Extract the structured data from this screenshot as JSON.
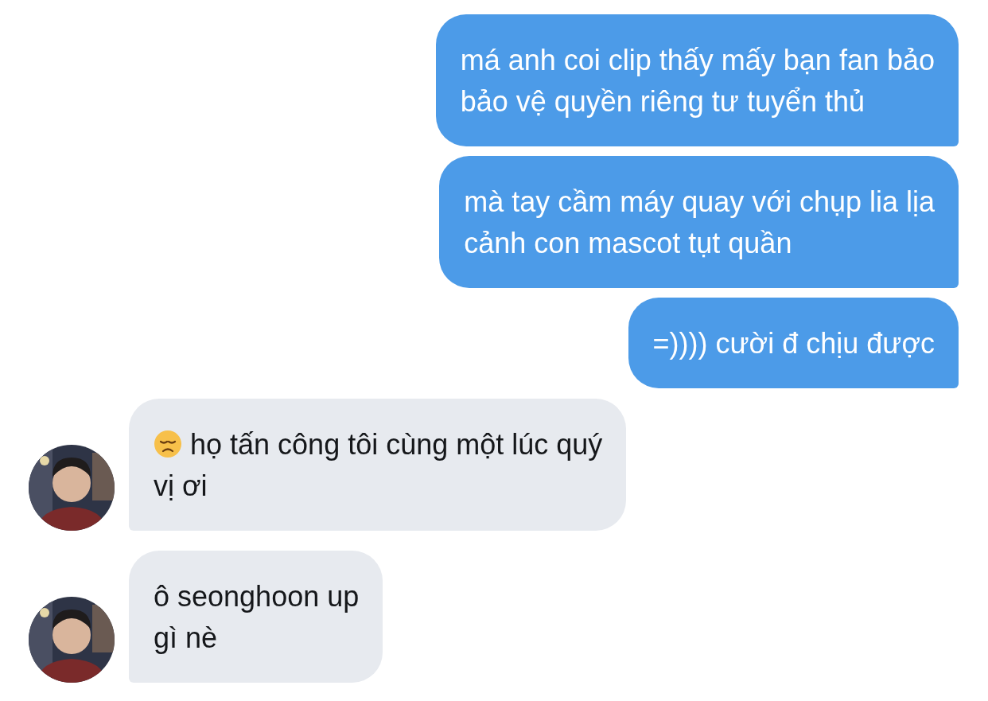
{
  "messages": [
    {
      "kind": "outgoing",
      "lines": [
        "má anh coi clip thấy mấy bạn fan bảo",
        "bảo vệ quyền riêng tư tuyển thủ"
      ]
    },
    {
      "kind": "outgoing",
      "lines": [
        "mà tay cầm máy quay với chụp lia lịa",
        "cảnh con mascot tụt quần"
      ]
    },
    {
      "kind": "outgoing",
      "lines": [
        "=)))) cười đ chịu được"
      ]
    },
    {
      "kind": "incoming",
      "has_emoji": true,
      "lines": [
        "họ tấn công tôi cùng một lúc quý",
        "vị ơi"
      ]
    },
    {
      "kind": "incoming",
      "has_emoji": false,
      "lines": [
        "ô seonghoon up",
        "gì nè"
      ]
    }
  ]
}
